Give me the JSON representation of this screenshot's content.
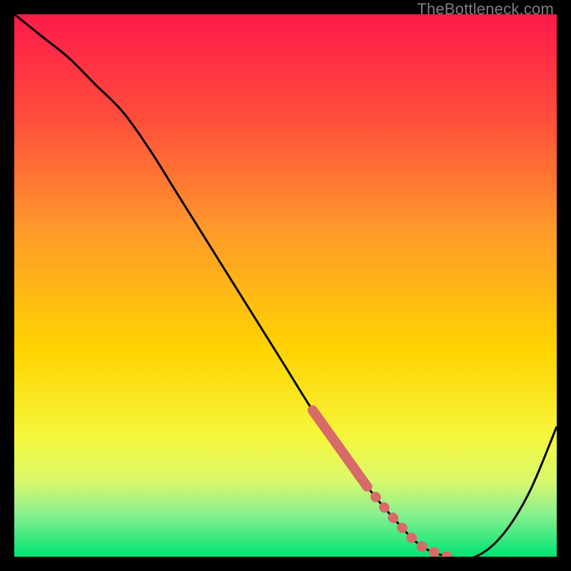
{
  "watermark": "TheBottleneck.com",
  "colors": {
    "frame_bg": "#000000",
    "gradient_top": "#ff1a4b",
    "gradient_mid": "#ffd400",
    "gradient_bottom": "#00e373",
    "curve": "#000000",
    "highlight": "#d86a68"
  },
  "chart_data": {
    "type": "line",
    "title": "",
    "xlabel": "",
    "ylabel": "",
    "xlim": [
      0,
      100
    ],
    "ylim": [
      0,
      100
    ],
    "x": [
      0,
      5,
      10,
      15,
      20,
      25,
      30,
      35,
      40,
      45,
      50,
      55,
      60,
      65,
      70,
      75,
      80,
      85,
      90,
      95,
      100
    ],
    "y": [
      100,
      96,
      92,
      87,
      82,
      75,
      67,
      59,
      51,
      43,
      35,
      27,
      20,
      13,
      7,
      2,
      0,
      0,
      4,
      12,
      24
    ],
    "highlight_segment": {
      "x_start": 55,
      "x_end": 80
    }
  }
}
